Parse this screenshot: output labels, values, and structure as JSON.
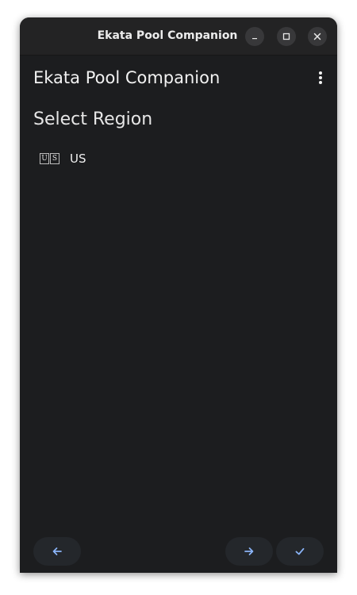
{
  "window": {
    "title": "Ekata Pool Companion"
  },
  "app_bar": {
    "title": "Ekata Pool Companion",
    "menu_icon": "more-vert-icon"
  },
  "page": {
    "heading": "Select Region"
  },
  "regions": [
    {
      "flag_letters": [
        "U",
        "S"
      ],
      "label": "US"
    }
  ],
  "navigation": {
    "back_icon": "arrow-left-icon",
    "next_icon": "arrow-right-icon",
    "done_icon": "check-icon",
    "accent_color": "#8ab4f8"
  }
}
